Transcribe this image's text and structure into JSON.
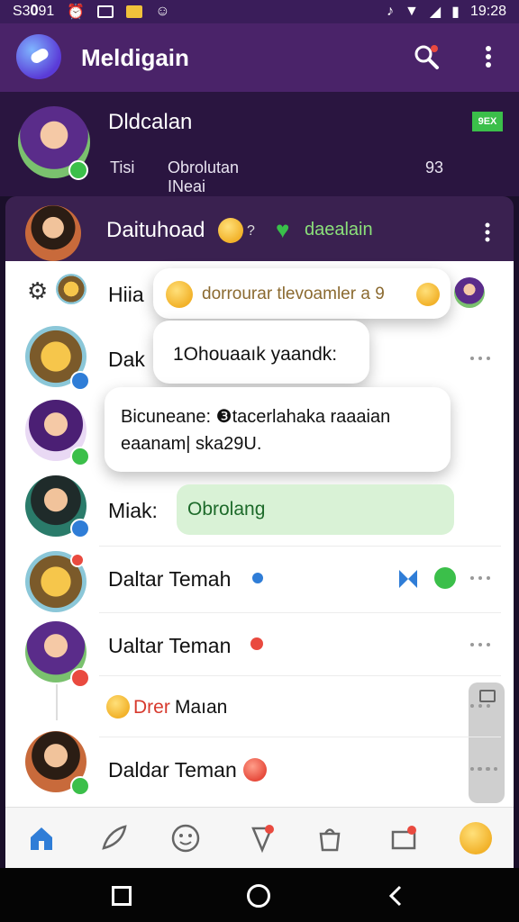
{
  "status_bar": {
    "left_text": "S3𝟎91",
    "time": "19:28"
  },
  "header": {
    "title": "Meldigain"
  },
  "profile": {
    "name": "Dldcalan",
    "status_prefix": "Tisi",
    "status_text": "Obrolutan INeai Ratiosn",
    "status_count": "93",
    "tag": "9EX"
  },
  "chat_head": {
    "name": "Daituhoad",
    "suffix": "?",
    "tag": "daealain"
  },
  "rows": [
    {
      "name": "Hiia",
      "bubble": "dorrourar tlevoamler a 9"
    },
    {
      "name": "Dak",
      "bubble": "1Ohouaaık yaandk:"
    },
    {
      "name": "",
      "bubble": "Bicuneane: ❸tacerlahaka raaaian eaanam| ska29U."
    },
    {
      "name": "Miak:",
      "bubble": "Obrolang"
    },
    {
      "name": "Daltar Temah"
    },
    {
      "name": "Ualtar Teman"
    },
    {
      "name": "Drer Maıan",
      "prefix": "Drer",
      "suffix": "Maıan"
    },
    {
      "name": "Daldar Teman"
    }
  ],
  "bottom_nav": [
    {
      "icon": "home-icon"
    },
    {
      "icon": "feather-icon"
    },
    {
      "icon": "smile-icon"
    },
    {
      "icon": "pin-icon"
    },
    {
      "icon": "bag-icon"
    },
    {
      "icon": "tag-icon"
    },
    {
      "icon": "emoji-icon"
    }
  ],
  "colors": {
    "accent": "#4a2369",
    "accent_dark": "#2a1540",
    "green": "#3bbf4a",
    "link_blue": "#2f7dd7"
  }
}
